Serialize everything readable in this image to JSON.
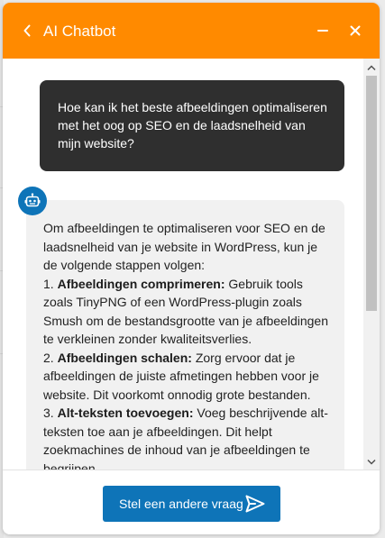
{
  "header": {
    "title": "AI Chatbot",
    "background_color": "#ff8a00"
  },
  "messages": {
    "user": "Hoe kan ik het beste afbeeldingen optimaliseren met het oog op SEO en de laadsnelheid van mijn website?",
    "bot": {
      "intro": "Om afbeeldingen te optimaliseren voor SEO en de laadsnelheid van je website in WordPress, kun je de volgende stappen volgen:",
      "steps": [
        {
          "number": "1.",
          "title": "Afbeeldingen comprimeren:",
          "text": "Gebruik tools zoals TinyPNG of een WordPress-plugin zoals Smush om de bestandsgrootte van je afbeeldingen te verkleinen zonder kwaliteitsverlies."
        },
        {
          "number": "2.",
          "title": "Afbeeldingen schalen:",
          "text": "Zorg ervoor dat je afbeeldingen de juiste afmetingen hebben voor je website. Dit voorkomt onnodig grote bestanden."
        },
        {
          "number": "3.",
          "title": "Alt-teksten toevoegen:",
          "text": "Voeg beschrijvende alt-teksten toe aan je afbeeldingen. Dit helpt zoekmachines de inhoud van je afbeeldingen te begrijpen."
        }
      ]
    }
  },
  "footer": {
    "ask_button_label": "Stel een andere vraag"
  },
  "colors": {
    "accent": "#0e74b8",
    "user_bubble": "#2f2f2f",
    "bot_bubble": "#f1f1f1"
  },
  "icons": {
    "back": "chevron-left-icon",
    "minimize": "minimize-icon",
    "close": "close-icon",
    "bot": "robot-icon",
    "send": "send-icon"
  }
}
